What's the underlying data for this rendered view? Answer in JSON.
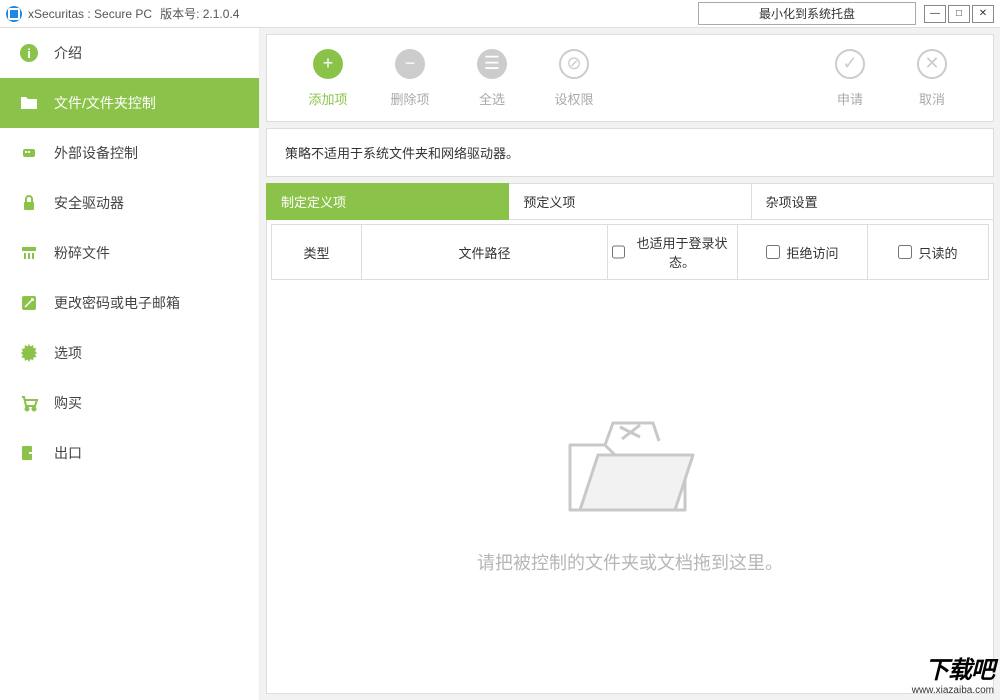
{
  "title": {
    "app": "xSecuritas : Secure PC",
    "version_prefix": "版本号: ",
    "version": "2.1.0.4",
    "tray_button": "最小化到系统托盘"
  },
  "sidebar": {
    "items": [
      {
        "label": "介绍"
      },
      {
        "label": "文件/文件夹控制"
      },
      {
        "label": "外部设备控制"
      },
      {
        "label": "安全驱动器"
      },
      {
        "label": "粉碎文件"
      },
      {
        "label": "更改密码或电子邮箱"
      },
      {
        "label": "选项"
      },
      {
        "label": "购买"
      },
      {
        "label": "出口"
      }
    ]
  },
  "toolbar": {
    "add": "添加项",
    "remove": "删除项",
    "select_all": "全选",
    "permissions": "设权限",
    "apply": "申请",
    "cancel": "取消"
  },
  "notice": "策略不适用于系统文件夹和网络驱动器。",
  "tabs": {
    "custom": "制定定义项",
    "preset": "预定义项",
    "misc": "杂项设置"
  },
  "table": {
    "type": "类型",
    "path": "文件路径",
    "login": "也适用于登录状态。",
    "deny": "拒绝访问",
    "readonly": "只读的"
  },
  "empty": "请把被控制的文件夹或文档拖到这里。",
  "watermark": {
    "brand": "下载吧",
    "url": "www.xiazaiba.com"
  }
}
